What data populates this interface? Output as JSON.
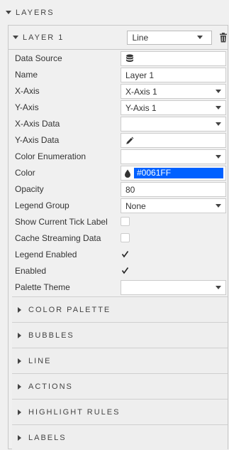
{
  "layers": {
    "title": "LAYERS"
  },
  "layer": {
    "title": "LAYER 1",
    "type_value": "Line"
  },
  "properties": {
    "data_source": "Data Source",
    "name": "Name",
    "name_value": "Layer 1",
    "x_axis": "X-Axis",
    "x_axis_value": "X-Axis 1",
    "y_axis": "Y-Axis",
    "y_axis_value": "Y-Axis 1",
    "x_axis_data": "X-Axis Data",
    "y_axis_data": "Y-Axis Data",
    "color_enumeration": "Color Enumeration",
    "color": "Color",
    "color_value": "#0061FF",
    "opacity": "Opacity",
    "opacity_value": "80",
    "legend_group": "Legend Group",
    "legend_group_value": "None",
    "show_current_tick_label": "Show Current Tick Label",
    "cache_streaming_data": "Cache Streaming Data",
    "legend_enabled": "Legend Enabled",
    "enabled": "Enabled",
    "palette_theme": "Palette Theme"
  },
  "sections": {
    "color_palette": "COLOR PALETTE",
    "bubbles": "BUBBLES",
    "line": "LINE",
    "actions": "ACTIONS",
    "highlight_rules": "HIGHLIGHT RULES",
    "labels": "LABELS"
  },
  "colors": {
    "swatch": "#0061FF"
  }
}
